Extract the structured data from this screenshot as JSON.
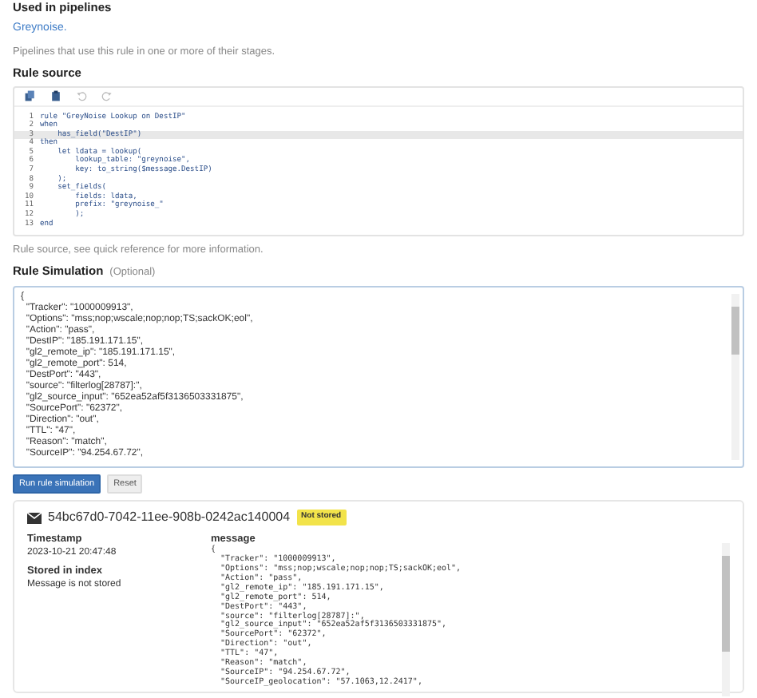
{
  "pipelines": {
    "heading": "Used in pipelines",
    "link": "Greynoise.",
    "help": "Pipelines that use this rule in one or more of their stages."
  },
  "rule_source": {
    "label": "Rule source",
    "help": "Rule source, see quick reference for more information.",
    "lines": [
      {
        "number": "1",
        "text": "rule \"GreyNoise Lookup on DestIP\"",
        "highlighted": false
      },
      {
        "number": "2",
        "text": "when",
        "highlighted": false
      },
      {
        "number": "3",
        "text": "    has_field(\"DestIP\")",
        "highlighted": true
      },
      {
        "number": "4",
        "text": "then",
        "highlighted": false
      },
      {
        "number": "5",
        "text": "    let ldata = lookup(",
        "highlighted": false
      },
      {
        "number": "6",
        "text": "        lookup_table: \"greynoise\",",
        "highlighted": false
      },
      {
        "number": "7",
        "text": "        key: to_string($message.DestIP)",
        "highlighted": false
      },
      {
        "number": "8",
        "text": "    );",
        "highlighted": false
      },
      {
        "number": "9",
        "text": "    set_fields(",
        "highlighted": false
      },
      {
        "number": "10",
        "text": "        fields: ldata,",
        "highlighted": false
      },
      {
        "number": "11",
        "text": "        prefix: \"greynoise_\"",
        "highlighted": false
      },
      {
        "number": "12",
        "text": "        );",
        "highlighted": false
      },
      {
        "number": "13",
        "text": "end",
        "highlighted": false
      }
    ]
  },
  "simulation": {
    "label": "Rule Simulation",
    "optional": "(Optional)",
    "lines": [
      "{",
      "  \"Tracker\": \"1000009913\",",
      "  \"Options\": \"mss;nop;wscale;nop;nop;TS;sackOK;eol\",",
      "  \"Action\": \"pass\",",
      "  \"DestIP\": \"185.191.171.15\",",
      "  \"gl2_remote_ip\": \"185.191.171.15\",",
      "  \"gl2_remote_port\": 514,",
      "  \"DestPort\": \"443\",",
      "  \"source\": \"filterlog[28787]:\",",
      "  \"gl2_source_input\": \"652ea52af5f3136503331875\",",
      "  \"SourcePort\": \"62372\",",
      "  \"Direction\": \"out\",",
      "  \"TTL\": \"47\",",
      "  \"Reason\": \"match\",",
      "  \"SourceIP\": \"94.254.67.72\","
    ],
    "buttons": [
      {
        "label": "Run rule simulation",
        "kind": "primary"
      },
      {
        "label": "Reset",
        "kind": "secondary"
      }
    ]
  },
  "result": {
    "message_id": "54bc67d0-7042-11ee-908b-0242ac140004",
    "badge": "Not stored",
    "fields": [
      {
        "label": "Timestamp",
        "value": "2023-10-21 20:47:48"
      },
      {
        "label": "Stored in index",
        "value": "Message is not stored"
      }
    ],
    "message_label": "message",
    "message_lines": [
      "{",
      "  \"Tracker\": \"1000009913\",",
      "  \"Options\": \"mss;nop;wscale;nop;nop;TS;sackOK;eol\",",
      "  \"Action\": \"pass\",",
      "  \"gl2_remote_ip\": \"185.191.171.15\",",
      "  \"gl2_remote_port\": 514,",
      "  \"DestPort\": \"443\",",
      "  \"source\": \"filterlog[28787]:\",",
      "  \"gl2_source_input\": \"652ea52af5f3136503331875\",",
      "  \"SourcePort\": \"62372\",",
      "  \"Direction\": \"out\",",
      "  \"TTL\": \"47\",",
      "  \"Reason\": \"match\",",
      "  \"SourceIP\": \"94.254.67.72\",",
      "  \"SourceIP_geolocation\": \"57.1063,12.2417\","
    ]
  }
}
